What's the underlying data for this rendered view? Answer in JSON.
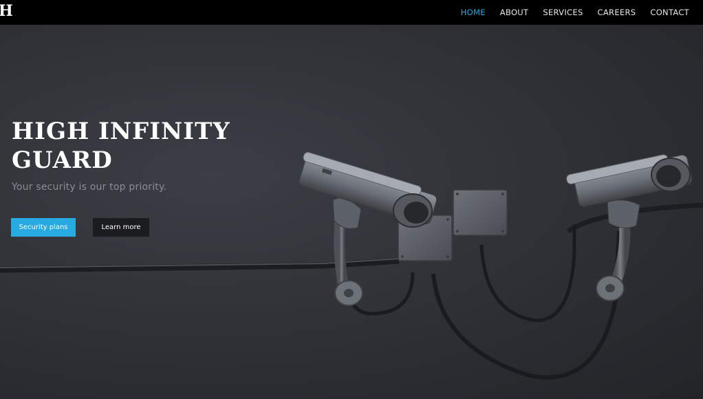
{
  "brand": {
    "logo_text": "H"
  },
  "nav": {
    "items": [
      {
        "label": "HOME",
        "active": true
      },
      {
        "label": "ABOUT",
        "active": false
      },
      {
        "label": "SERVICES",
        "active": false
      },
      {
        "label": "CAREERS",
        "active": false
      },
      {
        "label": "CONTACT",
        "active": false
      }
    ]
  },
  "hero": {
    "title": "HIGH INFINITY GUARD",
    "subtitle": "Your security is our top priority.",
    "primary_button": "Security plans",
    "secondary_button": "Learn more",
    "image_description_icon": "security-camera-icon"
  },
  "colors": {
    "accent": "#27a9e1",
    "navbar": "#000000",
    "dark_button": "#1b1c20",
    "wall": "#33353b"
  }
}
